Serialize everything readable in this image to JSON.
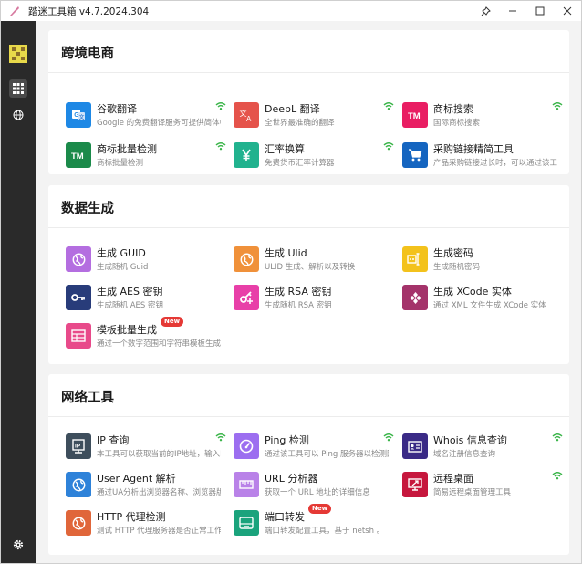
{
  "window": {
    "title": "踏迷工具箱 v4.7.2024.304",
    "buttons": {
      "pin": "⚲",
      "minimize": "—",
      "maximize": "☐",
      "close": "✕"
    }
  },
  "sidebar": {
    "items": [
      {
        "name": "apps",
        "icon": "grid-icon",
        "active": true
      },
      {
        "name": "web",
        "icon": "globe-icon",
        "active": false
      }
    ],
    "settings_icon": "gear-icon"
  },
  "sections": [
    {
      "title": "跨境电商",
      "tools": [
        {
          "name": "谷歌翻译",
          "desc": "Google 的免费翻译服务可提供简体中文和另外",
          "icon": "google-translate-icon",
          "color": "#1e88e5",
          "wifi": true
        },
        {
          "name": "DeepL 翻译",
          "desc": "全世界最准确的翻译",
          "icon": "translate-icon",
          "color": "#e5534b",
          "wifi": true
        },
        {
          "name": "商标搜索",
          "desc": "国际商标搜索",
          "icon": "tm-icon",
          "color": "#e91e63",
          "wifi": true
        },
        {
          "name": "商标批量检测",
          "desc": "商标批量检测",
          "icon": "tm-icon",
          "color": "#1b8a4a",
          "wifi": true
        },
        {
          "name": "汇率换算",
          "desc": "免费货币汇率计算器",
          "icon": "yen-icon",
          "color": "#21b28e",
          "wifi": true
        },
        {
          "name": "采购链接精简工具",
          "desc": "产品采购链接过长时，可以通过该工具进行精简",
          "icon": "cart-icon",
          "color": "#1565c0",
          "wifi": false
        }
      ]
    },
    {
      "title": "数据生成",
      "tools": [
        {
          "name": "生成 GUID",
          "desc": "生成随机 Guid",
          "icon": "globe-icon",
          "color": "#b46ee0"
        },
        {
          "name": "生成 Ulid",
          "desc": "ULID 生成、解析以及转换",
          "icon": "globe-icon",
          "color": "#f0913a"
        },
        {
          "name": "生成密码",
          "desc": "生成随机密码",
          "icon": "password-icon",
          "color": "#f3c21c"
        },
        {
          "name": "生成 AES 密钥",
          "desc": "生成随机 AES 密钥",
          "icon": "key-icon",
          "color": "#283c7a"
        },
        {
          "name": "生成 RSA 密钥",
          "desc": "生成随机 RSA 密钥",
          "icon": "key-plus-icon",
          "color": "#e83fa8"
        },
        {
          "name": "生成 XCode 实体",
          "desc": "通过 XML 文件生成 XCode 实体",
          "icon": "puzzle-icon",
          "color": "#a4336a"
        },
        {
          "name": "模板批量生成",
          "desc": "通过一个数字范围和字符串模板生成批量数据",
          "icon": "template-icon",
          "color": "#e84a8a",
          "badge": "New"
        }
      ]
    },
    {
      "title": "网络工具",
      "tools": [
        {
          "name": "IP 查询",
          "desc": "本工具可以获取当前的IP地址，输入IP后查询",
          "icon": "ip-icon",
          "color": "#3e4e5c",
          "wifi": true
        },
        {
          "name": "Ping 检测",
          "desc": "通过该工具可以 Ping 服务器以检测网络状况",
          "icon": "gauge-icon",
          "color": "#9c6ef0",
          "wifi": true
        },
        {
          "name": "Whois 信息查询",
          "desc": "域名注册信息查询",
          "icon": "id-card-icon",
          "color": "#3a2a86",
          "wifi": true
        },
        {
          "name": "User Agent 解析",
          "desc": "通过UA分析出浏览器名称、浏览器版本等信息",
          "icon": "globe-icon",
          "color": "#2e82d9",
          "wifi": false
        },
        {
          "name": "URL 分析器",
          "desc": "获取一个 URL 地址的详细信息",
          "icon": "ruler-icon",
          "color": "#b982e8",
          "wifi": false
        },
        {
          "name": "远程桌面",
          "desc": "简易远程桌面管理工具",
          "icon": "remote-desktop-icon",
          "color": "#c6173d",
          "wifi": true
        },
        {
          "name": "HTTP 代理检测",
          "desc": "测试 HTTP 代理服务器是否正常工作",
          "icon": "globe-icon",
          "color": "#e0663a",
          "wifi": false
        },
        {
          "name": "端口转发",
          "desc": "端口转发配置工具，基于 netsh 。",
          "icon": "port-icon",
          "color": "#1aa37c",
          "wifi": false,
          "badge": "New"
        }
      ]
    }
  ]
}
